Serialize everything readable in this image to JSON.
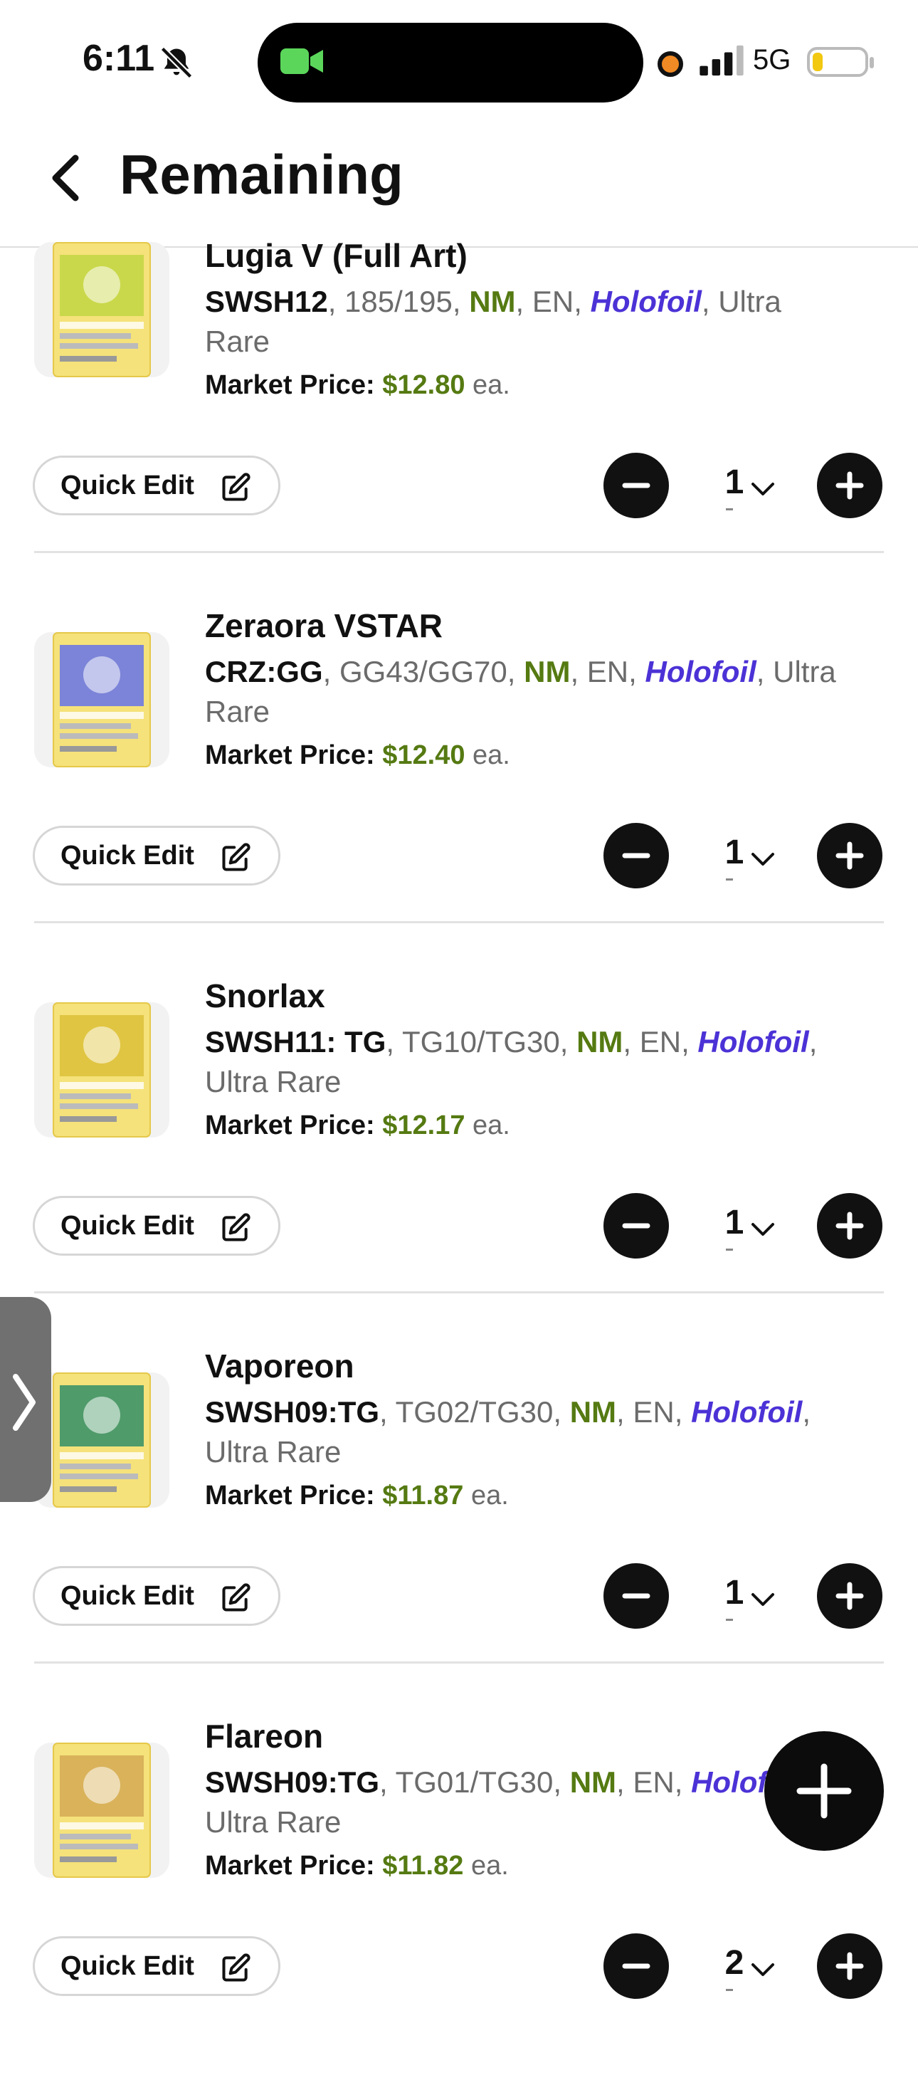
{
  "status_bar": {
    "time": "6:11",
    "network": "5G"
  },
  "header": {
    "title": "Remaining"
  },
  "price_label": "Market Price:",
  "price_suffix": "ea.",
  "quick_edit_label": "Quick Edit",
  "items": [
    {
      "name": "Lugia V (Full Art)",
      "set": "SWSH12",
      "number": ", 185/195, ",
      "condition": "NM",
      "lang": ", EN, ",
      "printing": "Holofoil",
      "rarity": ", Ultra Rare",
      "price": "$12.80",
      "quantity": "1"
    },
    {
      "name": "Zeraora VSTAR",
      "set": "CRZ:GG",
      "number": ", GG43/GG70, ",
      "condition": "NM",
      "lang": ", EN, ",
      "printing": "Holofoil",
      "rarity": ", Ultra Rare",
      "price": "$12.40",
      "quantity": "1"
    },
    {
      "name": "Snorlax",
      "set": "SWSH11: TG",
      "number": ", TG10/TG30, ",
      "condition": "NM",
      "lang": ", EN, ",
      "printing": "Holofoil",
      "rarity": ", Ultra Rare",
      "price": "$12.17",
      "quantity": "1"
    },
    {
      "name": "Vaporeon",
      "set": "SWSH09:TG",
      "number": ", TG02/TG30, ",
      "condition": "NM",
      "lang": ", EN, ",
      "printing": "Holofoil",
      "rarity": ", Ultra Rare",
      "price": "$11.87",
      "quantity": "1"
    },
    {
      "name": "Flareon",
      "set": "SWSH09:TG",
      "number": ", TG01/TG30, ",
      "condition": "NM",
      "lang": ", EN, ",
      "printing": "Holofoil",
      "rarity": ", Ultra Rare",
      "price": "$11.82",
      "quantity": "2"
    }
  ],
  "colors": {
    "condition_green": "#557a12",
    "holofoil_purple": "#4b32d6",
    "card_art": [
      "#c9d84a",
      "#7b84d8",
      "#e0c542",
      "#4f9b6a",
      "#d9b25a"
    ]
  }
}
